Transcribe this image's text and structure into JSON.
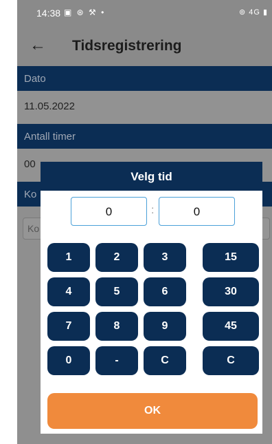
{
  "status_bar": {
    "time": "14:38",
    "left_icons": "▣ ⊛ ⚒ •",
    "right_icons": "⊚ 4G ▮"
  },
  "app_bar": {
    "back_glyph": "←",
    "title": "Tidsregistrering"
  },
  "form": {
    "date_label": "Dato",
    "date_value": "11.05.2022",
    "hours_label": "Antall timer",
    "hours_value": "00",
    "comment_label": "Ko",
    "comment_placeholder": "Ko"
  },
  "dialog": {
    "title": "Velg tid",
    "hours": "0",
    "separator": ":",
    "minutes": "0",
    "keypad": [
      "1",
      "2",
      "3",
      "4",
      "5",
      "6",
      "7",
      "8",
      "9",
      "0",
      "-",
      "C"
    ],
    "quick_keys": [
      "15",
      "30",
      "45",
      "C"
    ],
    "ok_label": "OK"
  },
  "colors": {
    "navy": "#0b2d54",
    "orange": "#f08a3c",
    "field_border": "#4aa0d8"
  }
}
